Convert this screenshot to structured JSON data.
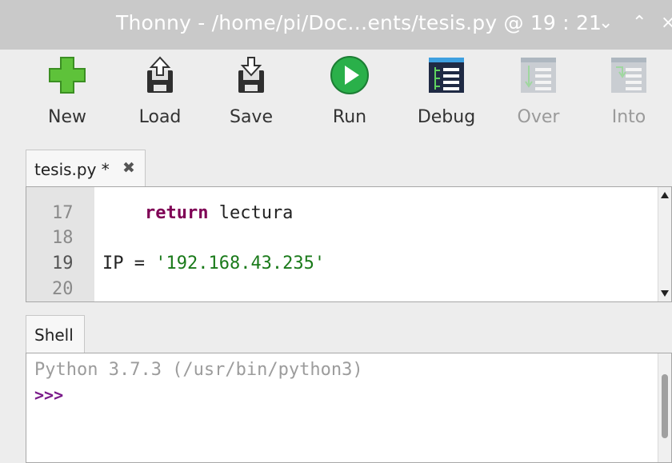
{
  "window": {
    "title": "Thonny  -  /home/pi/Doc…ents/tesis.py  @  19 : 21",
    "controls": [
      "⌄",
      "⌃",
      "×"
    ]
  },
  "toolbar": {
    "new": "New",
    "load": "Load",
    "save": "Save",
    "run": "Run",
    "debug": "Debug",
    "over": "Over",
    "into": "Into"
  },
  "editor": {
    "tab_label": "tesis.py *",
    "close_glyph": "✖",
    "lines": [
      {
        "no": "17",
        "code_indent": "    ",
        "keyword": "return",
        "rest": " lectura",
        "string": ""
      },
      {
        "no": "18",
        "code_indent": "",
        "keyword": "",
        "rest": "",
        "string": ""
      },
      {
        "no": "19",
        "code_indent": "",
        "keyword": "",
        "rest": "IP = ",
        "string": "'192.168.43.235'"
      },
      {
        "no": "20",
        "code_indent": "",
        "keyword": "",
        "rest": "",
        "string": ""
      }
    ]
  },
  "shell": {
    "tab_label": "Shell",
    "banner": "Python 3.7.3 (/usr/bin/python3)",
    "prompt": ">>>"
  },
  "colors": {
    "keyword": "#7f0055",
    "string": "#1a7a1a",
    "prompt": "#7a1b8a",
    "titlebar": "#c9c9c9"
  }
}
